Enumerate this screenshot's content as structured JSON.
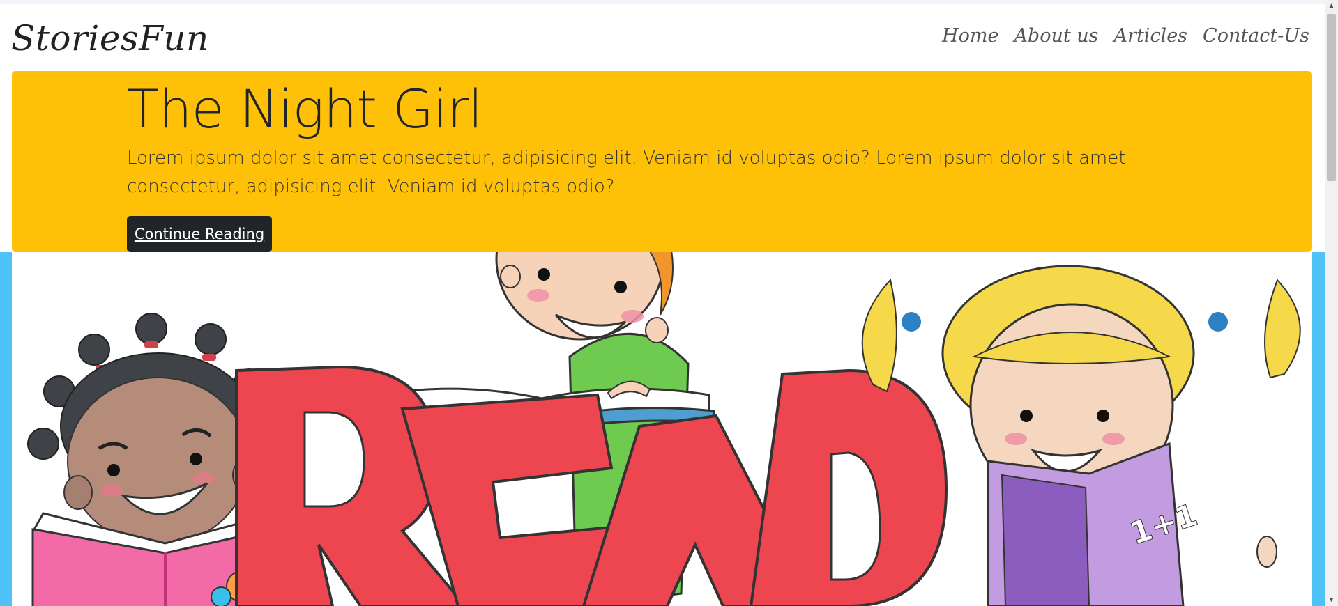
{
  "navbar": {
    "brand": "StoriesFun",
    "links": [
      "Home",
      "About us",
      "Articles",
      "Contact-Us"
    ]
  },
  "hero": {
    "title": "The Night Girl",
    "text": "Lorem ipsum dolor sit amet consectetur, adipisicing elit. Veniam id voluptas odio? Lorem ipsum dolor sit amet consectetur, adipisicing elit. Veniam id voluptas odio?",
    "button": "Continue Reading"
  },
  "illustration": {
    "letters": [
      "R",
      "E",
      "A",
      "D"
    ],
    "math_text": "1+1"
  },
  "colors": {
    "jumbotron": "#ffc107",
    "button": "#212529",
    "hero_background": "#4fc3f7",
    "read_letters": "#ee4650"
  },
  "icons": {
    "scroll_up": "triangle-up",
    "scroll_down": "triangle-down"
  }
}
